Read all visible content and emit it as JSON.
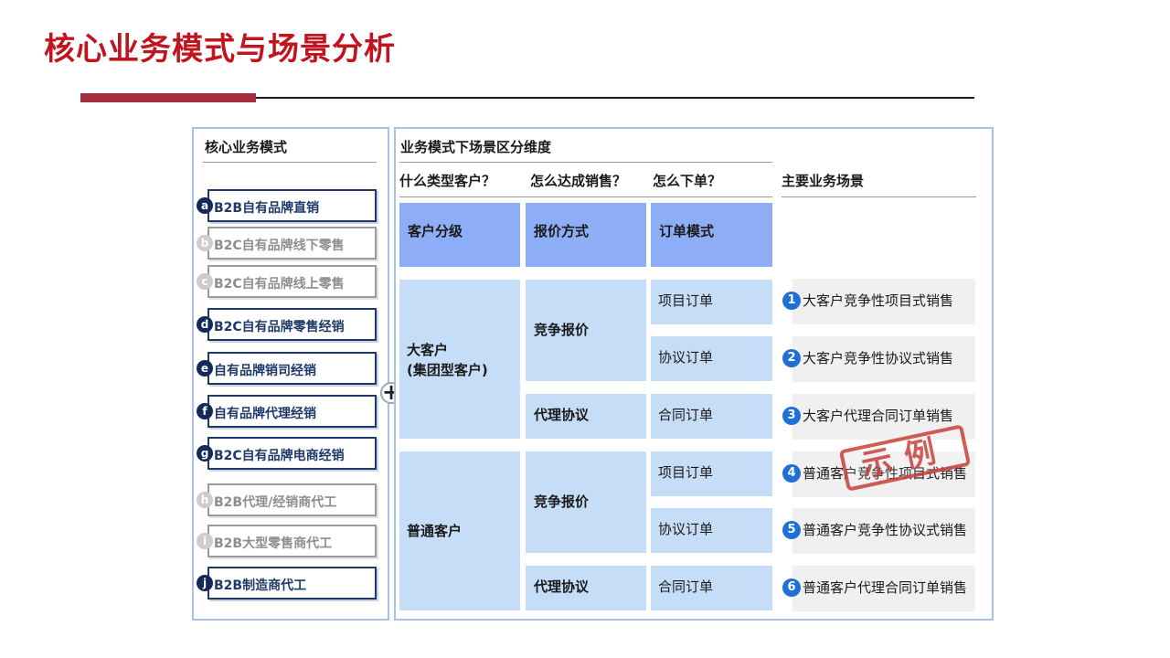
{
  "page_title": "核心业务模式与场景分析",
  "left_panel": {
    "header": "核心业务模式",
    "modes": [
      {
        "badge": "a",
        "label": "B2B自有品牌直销",
        "active": true
      },
      {
        "badge": "b",
        "label": "B2C自有品牌线下零售",
        "active": false
      },
      {
        "badge": "c",
        "label": "B2C自有品牌线上零售",
        "active": false
      },
      {
        "badge": "d",
        "label": "B2C自有品牌零售经销",
        "active": true
      },
      {
        "badge": "e",
        "label": "自有品牌销司经销",
        "active": true
      },
      {
        "badge": "f",
        "label": "自有品牌代理经销",
        "active": true
      },
      {
        "badge": "g",
        "label": "B2C自有品牌电商经销",
        "active": true
      },
      {
        "badge": "h",
        "label": "B2B代理/经销商代工",
        "active": false
      },
      {
        "badge": "i",
        "label": "B2B大型零售商代工",
        "active": false
      },
      {
        "badge": "j",
        "label": "B2B制造商代工",
        "active": true
      }
    ]
  },
  "right_panel": {
    "header": "业务模式下场景区分维度",
    "questions": [
      "什么类型客户？",
      "怎么达成销售？",
      "怎么下单？"
    ],
    "scenes_header": "主要业务场景",
    "dimension_headers": [
      "客户分级",
      "报价方式",
      "订单模式"
    ],
    "customers": [
      "大客户\n(集团型客户)",
      "普通客户"
    ],
    "quote_methods": [
      "竞争报价",
      "代理协议",
      "竞争报价",
      "代理协议"
    ],
    "order_modes": [
      "项目订单",
      "协议订单",
      "合同订单",
      "项目订单",
      "协议订单",
      "合同订单"
    ],
    "scenes": [
      {
        "num": "1",
        "text": "大客户竞争性项目式销售"
      },
      {
        "num": "2",
        "text": "大客户竞争性协议式销售"
      },
      {
        "num": "3",
        "text": "大客户代理合同订单销售"
      },
      {
        "num": "4",
        "text": "普通客户竞争性项目式销售"
      },
      {
        "num": "5",
        "text": "普通客户竞争性协议式销售"
      },
      {
        "num": "6",
        "text": "普通客户代理合同订单销售"
      }
    ],
    "stamp": "示例"
  },
  "colors": {
    "title": "#c0141e",
    "dark_cell": "#8eadf7",
    "light_cell": "#c5ddf7",
    "badge_active": "#13295a",
    "scene_num": "#1f6fd6",
    "stamp": "#c8413a"
  }
}
